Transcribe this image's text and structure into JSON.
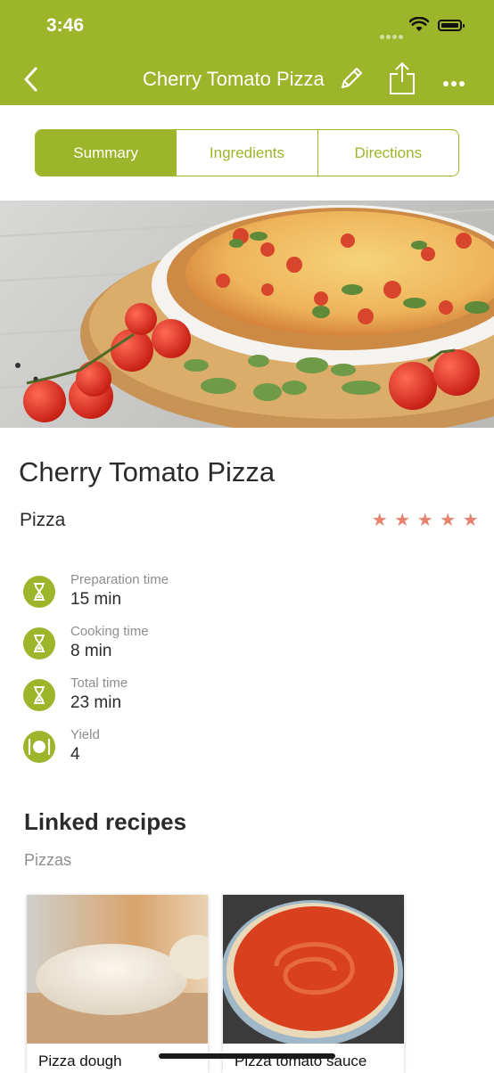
{
  "status_bar": {
    "time": "3:46"
  },
  "nav": {
    "title": "Cherry Tomato Pizza"
  },
  "tabs": [
    {
      "label": "Summary",
      "active": true
    },
    {
      "label": "Ingredients",
      "active": false
    },
    {
      "label": "Directions",
      "active": false
    }
  ],
  "recipe": {
    "title": "Cherry Tomato Pizza",
    "category": "Pizza",
    "rating": 5,
    "details": [
      {
        "label": "Preparation time",
        "value": "15 min",
        "icon": "hourglass-icon"
      },
      {
        "label": "Cooking time",
        "value": "8 min",
        "icon": "hourglass-icon"
      },
      {
        "label": "Total time",
        "value": "23 min",
        "icon": "hourglass-icon"
      },
      {
        "label": "Yield",
        "value": "4",
        "icon": "plate-cutlery-icon"
      }
    ]
  },
  "linked": {
    "title": "Linked recipes",
    "subtitle": "Pizzas",
    "cards": [
      {
        "label": "Pizza dough"
      },
      {
        "label": "Pizza tomato sauce"
      }
    ]
  },
  "colors": {
    "accent": "#9cb52a",
    "star": "#e8826f",
    "muted": "#8e8e8e"
  }
}
